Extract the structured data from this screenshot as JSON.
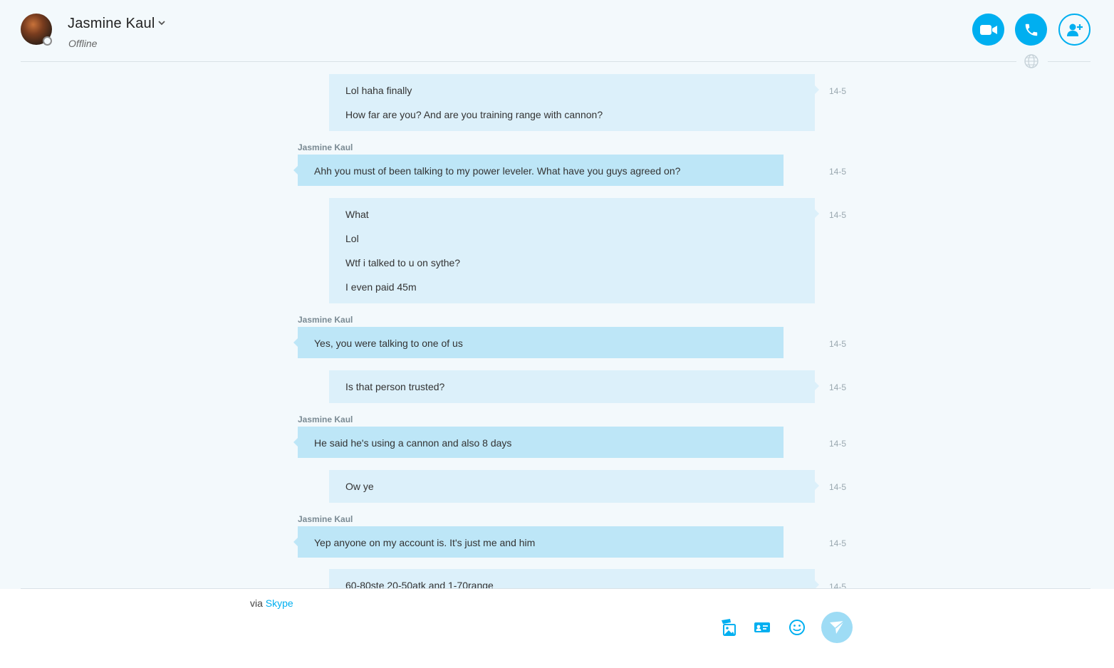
{
  "header": {
    "contact_name": "Jasmine Kaul",
    "status": "Offline",
    "buttons": [
      "video-call",
      "audio-call",
      "add-people"
    ]
  },
  "colors": {
    "accent": "#00aff0",
    "outgoing_bubble": "#dcf0fa",
    "incoming_bubble": "#bde6f7",
    "background": "#f3f9fc"
  },
  "messages": [
    {
      "direction": "out",
      "lines": [
        "Lol haha finally",
        "How far are you? And are you training range with cannon?"
      ],
      "time": "14-5"
    },
    {
      "direction": "in",
      "sender": "Jasmine Kaul",
      "lines": [
        "Ahh you must of been talking to my power leveler. What have you guys agreed on?"
      ],
      "time": "14-5"
    },
    {
      "direction": "out",
      "lines": [
        "What",
        "Lol",
        "Wtf i talked to u on sythe?",
        "I even paid 45m"
      ],
      "time": "14-5"
    },
    {
      "direction": "in",
      "sender": "Jasmine Kaul",
      "lines": [
        "Yes, you were talking to one of us"
      ],
      "time": "14-5"
    },
    {
      "direction": "out",
      "lines": [
        "Is that person trusted?"
      ],
      "time": "14-5"
    },
    {
      "direction": "in",
      "sender": "Jasmine Kaul",
      "lines": [
        "He said he's using a cannon and also 8 days"
      ],
      "time": "14-5"
    },
    {
      "direction": "out",
      "lines": [
        "Ow ye"
      ],
      "time": "14-5"
    },
    {
      "direction": "in",
      "sender": "Jasmine Kaul",
      "lines": [
        "Yep anyone on my account is. It's just me and him"
      ],
      "time": "14-5"
    },
    {
      "direction": "out",
      "lines": [
        "60-80ste 20-50atk and 1-70range"
      ],
      "time": "14-5"
    }
  ],
  "composer": {
    "via_prefix": "via",
    "via_link": "Skype",
    "tools": [
      "media-gallery",
      "contact-card",
      "emoji",
      "send"
    ]
  }
}
